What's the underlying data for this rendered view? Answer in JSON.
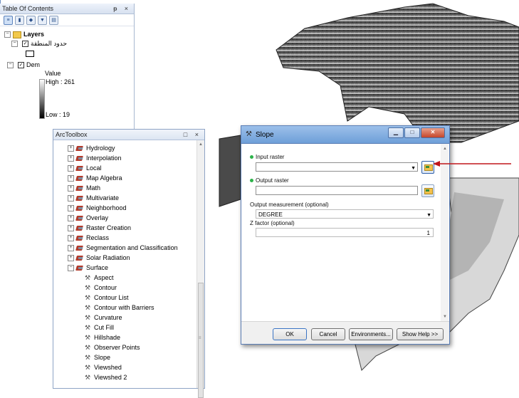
{
  "toc": {
    "title": "Table Of Contents",
    "pin": "ᵽ",
    "close": "×",
    "layers_label": "Layers",
    "boundary_layer": "حدود المنطقة",
    "dem_layer": "Dem",
    "legend_title": "Value",
    "high_label": "High : 261",
    "low_label": "Low : 19"
  },
  "toolbox": {
    "title": "ArcToolbox",
    "toolsets": [
      "Hydrology",
      "Interpolation",
      "Local",
      "Map Algebra",
      "Math",
      "Multivariate",
      "Neighborhood",
      "Overlay",
      "Raster Creation",
      "Reclass",
      "Segmentation and Classification",
      "Solar Radiation",
      "Surface"
    ],
    "surface_tools": [
      "Aspect",
      "Contour",
      "Contour List",
      "Contour with Barriers",
      "Curvature",
      "Cut Fill",
      "Hillshade",
      "Observer Points",
      "Slope",
      "Viewshed",
      "Viewshed 2"
    ]
  },
  "dialog": {
    "title": "Slope",
    "input_raster_label": "Input raster",
    "input_raster_value": "",
    "output_raster_label": "Output raster",
    "output_raster_value": "",
    "measurement_label": "Output measurement (optional)",
    "measurement_value": "DEGREE",
    "zfactor_label": "Z factor (optional)",
    "zfactor_value": "1",
    "ok_label": "OK",
    "cancel_label": "Cancel",
    "environments_label": "Environments...",
    "show_help_label": "Show Help >>"
  },
  "colors": {
    "arrow": "#c0161b",
    "title_bar": "#6e9fd8",
    "required_dot": "#2db34a"
  }
}
